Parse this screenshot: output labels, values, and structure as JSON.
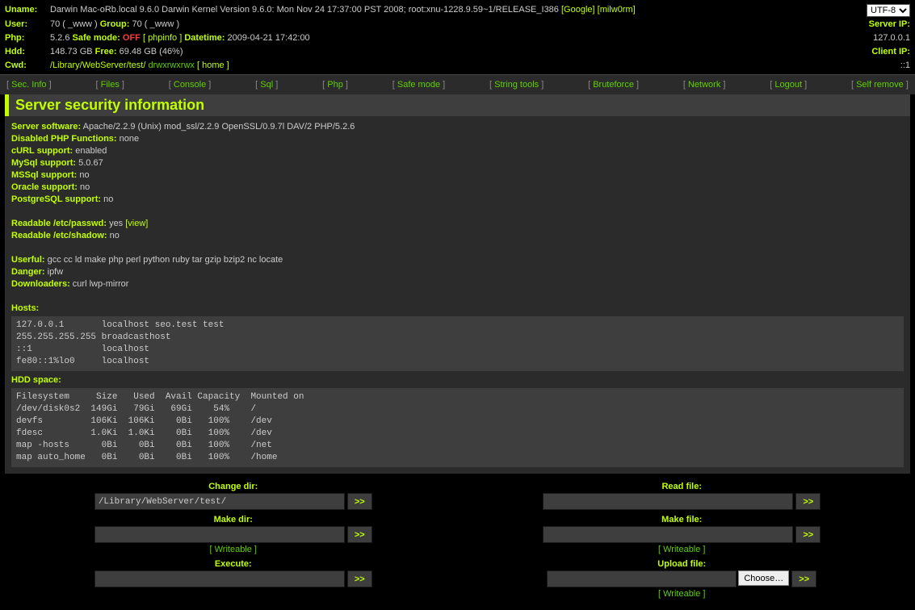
{
  "header": {
    "uname_label": "Uname:",
    "uname_value": "Darwin Mac-oRb.local 9.6.0 Darwin Kernel Version 9.6.0: Mon Nov 24 17:37:00 PST 2008; root:xnu-1228.9.59~1/RELEASE_I386",
    "uname_links": {
      "google": "[Google]",
      "milw0rm": "[milw0rm]"
    },
    "user_label": "User:",
    "user_value": "70 ( _www )",
    "group_label": "Group:",
    "group_value": "70 ( _www )",
    "php_label": "Php:",
    "php_version": "5.2.6",
    "safe_mode_label": "Safe mode:",
    "safe_mode_value": "OFF",
    "phpinfo_link": "[ phpinfo ]",
    "datetime_label": "Datetime:",
    "datetime_value": "2009-04-21 17:42:00",
    "hdd_label": "Hdd:",
    "hdd_total": "148.73 GB",
    "hdd_free_label": "Free:",
    "hdd_free": "69.48 GB (46%)",
    "cwd_label": "Cwd:",
    "cwd_path": "/Library/WebServer/test/",
    "cwd_perm": "drwxrwxrwx",
    "home_link": "[ home ]",
    "encoding": "UTF-8",
    "server_ip_label": "Server IP:",
    "server_ip": "127.0.0.1",
    "client_ip_label": "Client IP:",
    "client_ip": "::1"
  },
  "nav": [
    "Sec. Info",
    "Files",
    "Console",
    "Sql",
    "Php",
    "Safe mode",
    "String tools",
    "Bruteforce",
    "Network",
    "Logout",
    "Self remove"
  ],
  "title": "Server security information",
  "sec": {
    "server_software_k": "Server software:",
    "server_software_v": "Apache/2.2.9 (Unix) mod_ssl/2.2.9 OpenSSL/0.9.7l DAV/2 PHP/5.2.6",
    "disabled_k": "Disabled PHP Functions:",
    "disabled_v": "none",
    "curl_k": "cURL support:",
    "curl_v": "enabled",
    "mysql_k": "MySql support:",
    "mysql_v": "5.0.67",
    "mssql_k": "MSSql support:",
    "mssql_v": "no",
    "oracle_k": "Oracle support:",
    "oracle_v": "no",
    "pg_k": "PostgreSQL support:",
    "pg_v": "no",
    "passwd_k": "Readable /etc/passwd:",
    "passwd_v": "yes",
    "passwd_view": "[view]",
    "shadow_k": "Readable /etc/shadow:",
    "shadow_v": "no",
    "userful_k": "Userful:",
    "userful_v": "gcc cc ld make php perl python ruby tar gzip bzip2 nc locate",
    "danger_k": "Danger:",
    "danger_v": "ipfw",
    "downloaders_k": "Downloaders:",
    "downloaders_v": "curl lwp-mirror",
    "hosts_k": "Hosts:",
    "hosts_pre": "127.0.0.1       localhost seo.test test\n255.255.255.255 broadcasthost\n::1             localhost\nfe80::1%lo0     localhost",
    "hdd_k": "HDD space:",
    "hdd_pre": "Filesystem     Size   Used  Avail Capacity  Mounted on\n/dev/disk0s2  149Gi   79Gi   69Gi    54%    /\ndevfs         106Ki  106Ki    0Bi   100%    /dev\nfdesc         1.0Ki  1.0Ki    0Bi   100%    /dev\nmap -hosts      0Bi    0Bi    0Bi   100%    /net\nmap auto_home   0Bi    0Bi    0Bi   100%    /home"
  },
  "footer": {
    "change_dir": "Change dir:",
    "change_dir_value": "/Library/WebServer/test/",
    "read_file": "Read file:",
    "make_dir": "Make dir:",
    "make_file": "Make file:",
    "execute": "Execute:",
    "upload_file": "Upload file:",
    "writeable": "[ Writeable ]",
    "go": ">>",
    "choose": "Choose…"
  }
}
